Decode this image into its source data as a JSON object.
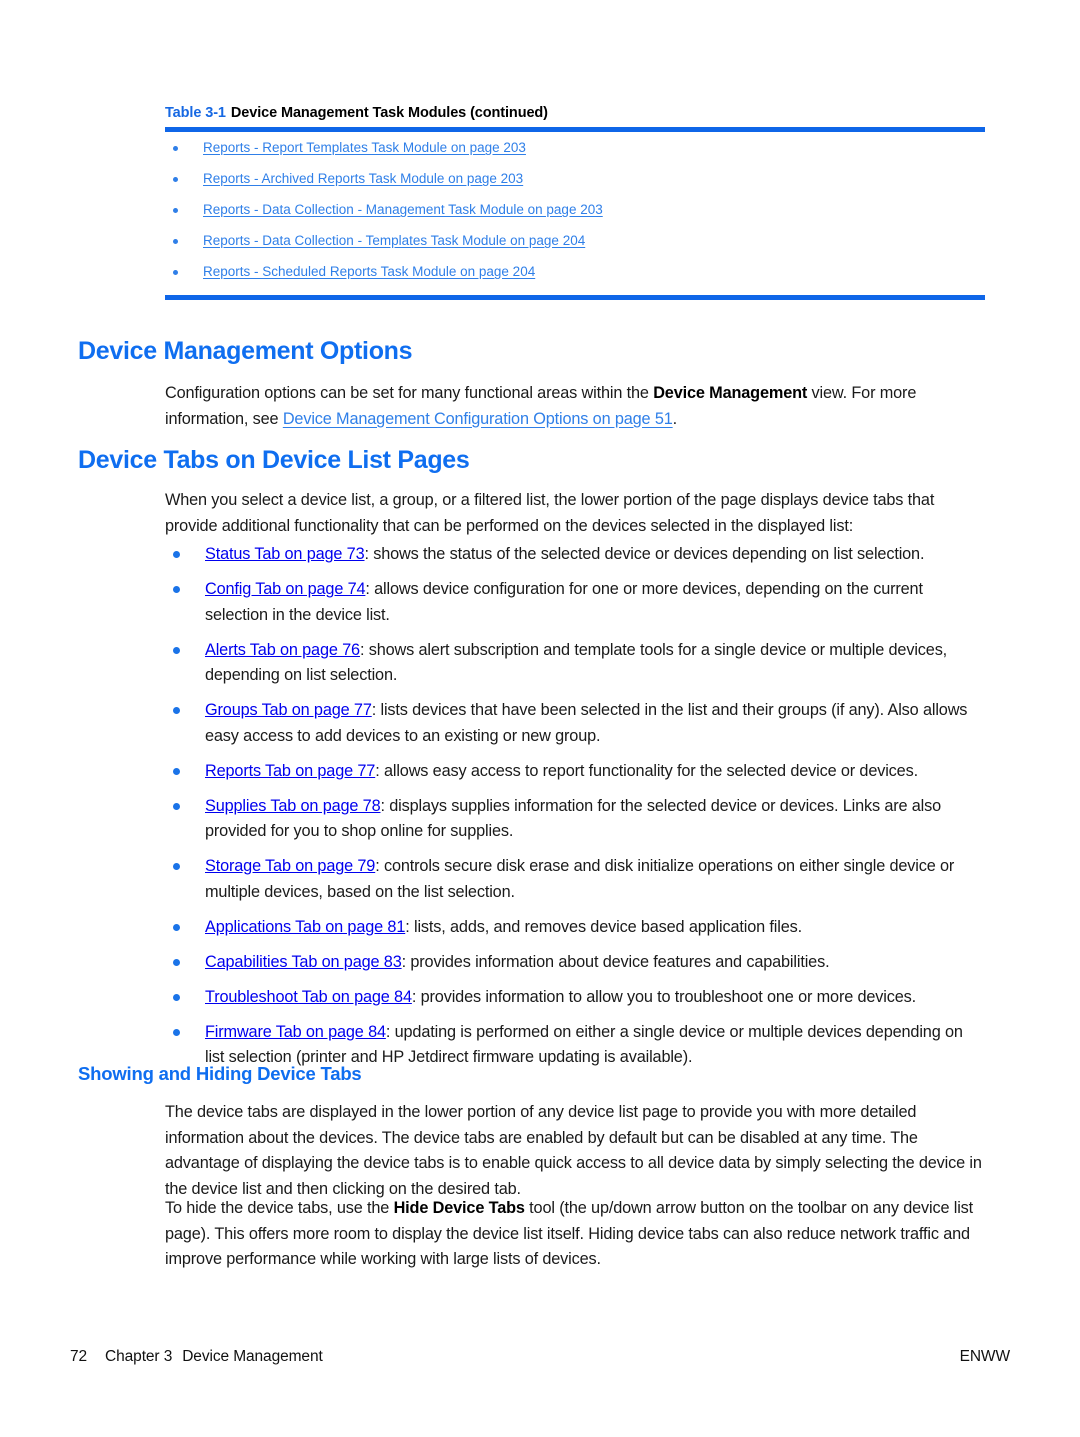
{
  "colors": {
    "heading_blue": "#0f6ef0",
    "link_blue": "#2f7fe8",
    "rule_blue": "#0f66e8",
    "body_text": "#1a1a1a"
  },
  "table": {
    "number": "Table 3-1",
    "title": "Device Management Task Modules (continued)",
    "items": [
      "Reports - Report Templates Task Module on page 203",
      "Reports - Archived Reports Task Module on page 203",
      "Reports - Data Collection - Management Task Module on page 203",
      "Reports - Data Collection - Templates Task Module on page 204",
      "Reports - Scheduled Reports Task Module on page 204"
    ]
  },
  "section_options": {
    "heading": "Device Management Options",
    "paragraph_pre": "Configuration options can be set for many functional areas within the ",
    "paragraph_bold": "Device Management",
    "paragraph_mid": " view. For more information, see ",
    "paragraph_link": "Device Management Configuration Options on page 51",
    "paragraph_post": "."
  },
  "section_tabs": {
    "heading": "Device Tabs on Device List Pages",
    "intro": "When you select a device list, a group, or a filtered list, the lower portion of the page displays device tabs that provide additional functionality that can be performed on the devices selected in the displayed list:",
    "bullets": [
      {
        "link": "Status Tab on page 73",
        "text": ": shows the status of the selected device or devices depending on list selection."
      },
      {
        "link": "Config Tab on page 74",
        "text": ": allows device configuration for one or more devices, depending on the current selection in the device list."
      },
      {
        "link": "Alerts Tab on page 76",
        "text": ": shows alert subscription and template tools for a single device or multiple devices, depending on list selection."
      },
      {
        "link": "Groups Tab on page 77",
        "text": ": lists devices that have been selected in the list and their groups (if any). Also allows easy access to add devices to an existing or new group."
      },
      {
        "link": "Reports Tab on page 77",
        "text": ": allows easy access to report functionality for the selected device or devices."
      },
      {
        "link": "Supplies Tab on page 78",
        "text": ": displays supplies information for the selected device or devices. Links are also provided for you to shop online for supplies."
      },
      {
        "link": "Storage Tab on page 79",
        "text": ": controls secure disk erase and disk initialize operations on either single device or multiple devices, based on the list selection."
      },
      {
        "link": "Applications Tab on page 81",
        "text": ": lists, adds, and removes device based application files."
      },
      {
        "link": "Capabilities Tab on page 83",
        "text": ": provides information about device features and capabilities."
      },
      {
        "link": "Troubleshoot Tab on page 84",
        "text": ": provides information to allow you to troubleshoot one or more devices."
      },
      {
        "link": "Firmware Tab on page 84",
        "text": ": updating is performed on either a single device or multiple devices depending on list selection (printer and HP Jetdirect firmware updating is available)."
      }
    ]
  },
  "section_showhide": {
    "heading": "Showing and Hiding Device Tabs",
    "paragraph1": "The device tabs are displayed in the lower portion of any device list page to provide you with more detailed information about the devices. The device tabs are enabled by default but can be disabled at any time. The advantage of displaying the device tabs is to enable quick access to all device data by simply selecting the device in the device list and then clicking on the desired tab.",
    "paragraph2_pre": "To hide the device tabs, use the ",
    "paragraph2_bold": "Hide Device Tabs",
    "paragraph2_post": " tool (the up/down arrow button on the toolbar on any device list page). This offers more room to display the device list itself. Hiding device tabs can also reduce network traffic and improve performance while working with large lists of devices."
  },
  "footer": {
    "page_number": "72",
    "chapter": "Chapter 3",
    "chapter_title": "Device Management",
    "imprint": "ENWW"
  }
}
